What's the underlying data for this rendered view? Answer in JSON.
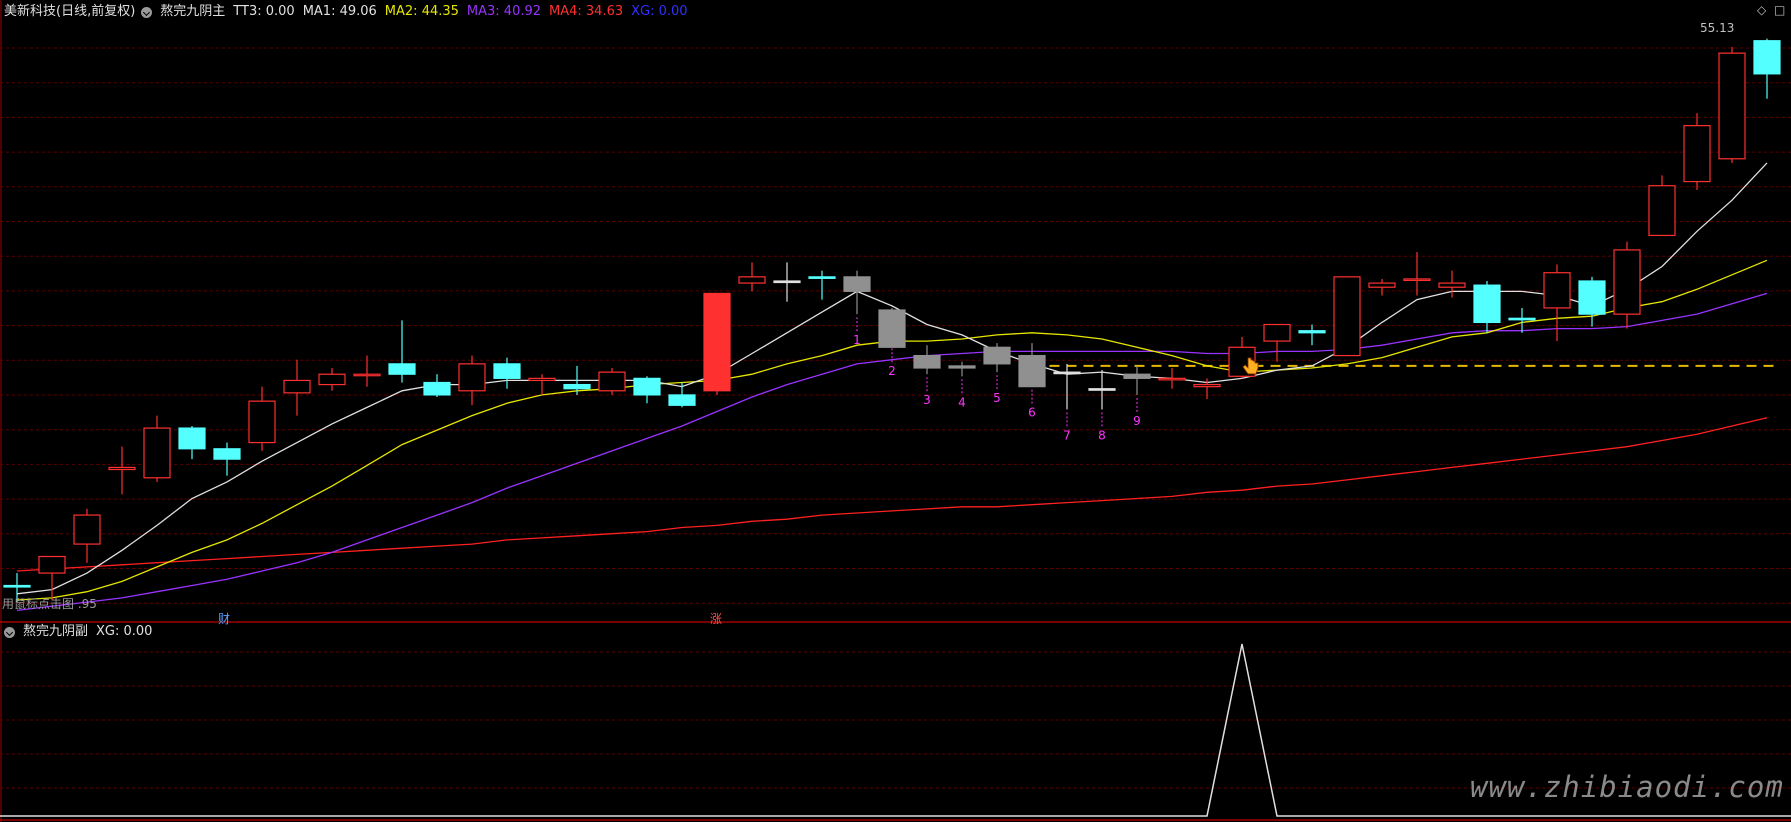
{
  "main_header": {
    "symbol": "美新科技(日线,前复权)",
    "indicator_name": "熬完九阴主",
    "items": [
      {
        "label": "TT3: 0.00",
        "color": "#e0e0e0"
      },
      {
        "label": "MA1: 49.06",
        "color": "#e0e0e0"
      },
      {
        "label": "MA2: 44.35",
        "color": "#e6e600"
      },
      {
        "label": "MA3: 40.92",
        "color": "#9933ff"
      },
      {
        "label": "MA4: 34.63",
        "color": "#ff3030"
      },
      {
        "label": "XG: 0.00",
        "color": "#3030ff"
      }
    ]
  },
  "sub_header": {
    "indicator_name": "熬完九阴副",
    "items": [
      {
        "label": "XG: 0.00",
        "color": "#e0e0e0"
      }
    ]
  },
  "labels": {
    "price_max": "55.13",
    "price_min_text": "用鼠标点击图 .95",
    "marker_cai": "财",
    "marker_zhang": "涨",
    "watermark": "www.zhibiaodi.com",
    "corner_diamond": "◇",
    "corner_box": "□"
  },
  "colors": {
    "up": "#ff3030",
    "down": "#54ffff",
    "neutral": "#909090",
    "grid": "#5a0000",
    "ma1": "#e0e0e0",
    "ma2": "#e6e600",
    "ma3": "#9933ff",
    "ma4": "#ff2020",
    "count": "#ff33ff",
    "support": "#e6b800"
  },
  "chart_data": [
    {
      "type": "candlestick",
      "yscale": [
        28,
        56
      ],
      "support_level": 39.3,
      "candles": [
        {
          "o": 28.7,
          "h": 29.3,
          "l": 27.9,
          "c": 28.7,
          "k": "d"
        },
        {
          "o": 29.3,
          "h": 29.9,
          "l": 28.0,
          "c": 30.1,
          "k": "u"
        },
        {
          "o": 30.7,
          "h": 32.4,
          "l": 29.8,
          "c": 32.1,
          "k": "u"
        },
        {
          "o": 34.3,
          "h": 35.4,
          "l": 33.1,
          "c": 34.4,
          "k": "u"
        },
        {
          "o": 33.9,
          "h": 36.9,
          "l": 33.7,
          "c": 36.3,
          "k": "u"
        },
        {
          "o": 36.3,
          "h": 36.4,
          "l": 34.8,
          "c": 35.3,
          "k": "d"
        },
        {
          "o": 35.3,
          "h": 35.6,
          "l": 34.0,
          "c": 34.8,
          "k": "d"
        },
        {
          "o": 35.6,
          "h": 38.3,
          "l": 35.2,
          "c": 37.6,
          "k": "u"
        },
        {
          "o": 38.0,
          "h": 39.6,
          "l": 36.9,
          "c": 38.6,
          "k": "u"
        },
        {
          "o": 38.4,
          "h": 39.2,
          "l": 38.1,
          "c": 38.9,
          "k": "u"
        },
        {
          "o": 38.9,
          "h": 39.8,
          "l": 38.3,
          "c": 38.9,
          "k": "u"
        },
        {
          "o": 39.4,
          "h": 41.5,
          "l": 38.5,
          "c": 38.9,
          "k": "d"
        },
        {
          "o": 38.5,
          "h": 38.9,
          "l": 37.8,
          "c": 37.9,
          "k": "d"
        },
        {
          "o": 38.1,
          "h": 39.8,
          "l": 37.4,
          "c": 39.4,
          "k": "u"
        },
        {
          "o": 39.4,
          "h": 39.7,
          "l": 38.2,
          "c": 38.7,
          "k": "d"
        },
        {
          "o": 38.7,
          "h": 38.9,
          "l": 37.9,
          "c": 38.6,
          "k": "u"
        },
        {
          "o": 38.4,
          "h": 39.3,
          "l": 37.9,
          "c": 38.2,
          "k": "d"
        },
        {
          "o": 38.1,
          "h": 39.2,
          "l": 37.9,
          "c": 39.0,
          "k": "u"
        },
        {
          "o": 38.7,
          "h": 38.8,
          "l": 37.5,
          "c": 37.9,
          "k": "d"
        },
        {
          "o": 37.9,
          "h": 38.5,
          "l": 37.3,
          "c": 37.4,
          "k": "d"
        },
        {
          "o": 38.1,
          "h": 42.8,
          "l": 37.9,
          "c": 42.8,
          "k": "u",
          "fill": true
        },
        {
          "o": 43.3,
          "h": 44.3,
          "l": 42.9,
          "c": 43.6,
          "k": "u"
        },
        {
          "o": 43.4,
          "h": 44.3,
          "l": 42.4,
          "c": 43.4,
          "k": "n"
        },
        {
          "o": 43.6,
          "h": 43.9,
          "l": 42.5,
          "c": 43.6,
          "k": "d"
        },
        {
          "o": 43.6,
          "h": 43.9,
          "l": 41.8,
          "c": 42.9,
          "k": "g"
        },
        {
          "o": 42.0,
          "h": 42.1,
          "l": 40.3,
          "c": 40.2,
          "k": "g"
        },
        {
          "o": 39.8,
          "h": 40.3,
          "l": 38.9,
          "c": 39.2,
          "k": "g"
        },
        {
          "o": 39.3,
          "h": 39.5,
          "l": 38.8,
          "c": 39.2,
          "k": "g"
        },
        {
          "o": 40.2,
          "h": 40.4,
          "l": 39.0,
          "c": 39.4,
          "k": "g"
        },
        {
          "o": 39.8,
          "h": 40.4,
          "l": 38.3,
          "c": 38.3,
          "k": "g"
        },
        {
          "o": 39.0,
          "h": 39.4,
          "l": 37.2,
          "c": 39.0,
          "k": "n"
        },
        {
          "o": 38.2,
          "h": 39.1,
          "l": 37.2,
          "c": 38.2,
          "k": "n"
        },
        {
          "o": 38.9,
          "h": 39.3,
          "l": 37.9,
          "c": 38.7,
          "k": "g"
        },
        {
          "o": 38.7,
          "h": 39.2,
          "l": 38.2,
          "c": 38.7,
          "k": "u"
        },
        {
          "o": 38.4,
          "h": 38.7,
          "l": 37.7,
          "c": 38.3,
          "k": "u"
        },
        {
          "o": 38.8,
          "h": 40.7,
          "l": 38.7,
          "c": 40.2,
          "k": "u"
        },
        {
          "o": 40.5,
          "h": 41.3,
          "l": 39.5,
          "c": 41.3,
          "k": "u"
        },
        {
          "o": 41.0,
          "h": 41.3,
          "l": 40.3,
          "c": 40.9,
          "k": "d"
        },
        {
          "o": 39.8,
          "h": 43.6,
          "l": 39.8,
          "c": 43.6,
          "k": "u"
        },
        {
          "o": 43.3,
          "h": 43.5,
          "l": 42.7,
          "c": 43.1,
          "k": "u"
        },
        {
          "o": 43.5,
          "h": 44.8,
          "l": 42.7,
          "c": 43.5,
          "k": "u"
        },
        {
          "o": 43.3,
          "h": 43.9,
          "l": 42.6,
          "c": 43.1,
          "k": "u"
        },
        {
          "o": 43.2,
          "h": 43.4,
          "l": 40.9,
          "c": 41.4,
          "k": "d"
        },
        {
          "o": 41.6,
          "h": 42.1,
          "l": 40.9,
          "c": 41.6,
          "k": "d"
        },
        {
          "o": 42.1,
          "h": 44.2,
          "l": 40.5,
          "c": 43.8,
          "k": "u"
        },
        {
          "o": 43.4,
          "h": 43.6,
          "l": 41.2,
          "c": 41.8,
          "k": "d"
        },
        {
          "o": 41.8,
          "h": 45.3,
          "l": 41.1,
          "c": 44.9,
          "k": "u"
        },
        {
          "o": 45.6,
          "h": 48.5,
          "l": 45.6,
          "c": 48.0,
          "k": "u"
        },
        {
          "o": 48.2,
          "h": 51.5,
          "l": 47.8,
          "c": 50.9,
          "k": "u"
        },
        {
          "o": 49.3,
          "h": 54.7,
          "l": 49.1,
          "c": 54.4,
          "k": "u"
        },
        {
          "o": 55.0,
          "h": 55.1,
          "l": 52.2,
          "c": 53.4,
          "k": "d"
        }
      ],
      "ma1": [
        28.3,
        28.5,
        29.3,
        30.4,
        31.6,
        32.9,
        33.7,
        34.7,
        35.6,
        36.5,
        37.3,
        38.1,
        38.4,
        38.4,
        38.6,
        38.6,
        38.6,
        38.6,
        38.6,
        38.3,
        38.9,
        39.9,
        40.9,
        41.9,
        42.9,
        42.2,
        41.3,
        40.8,
        40.0,
        39.4,
        38.9,
        39.0,
        38.8,
        38.7,
        38.5,
        38.7,
        39.1,
        39.3,
        40.2,
        41.4,
        42.5,
        42.9,
        42.9,
        42.9,
        42.7,
        42.2,
        43.0,
        44.1,
        45.8,
        47.3,
        49.1
      ],
      "ma2": [
        28.0,
        28.1,
        28.4,
        28.9,
        29.6,
        30.3,
        30.9,
        31.7,
        32.6,
        33.5,
        34.5,
        35.5,
        36.2,
        36.9,
        37.5,
        37.9,
        38.1,
        38.2,
        38.4,
        38.5,
        38.6,
        38.9,
        39.4,
        39.8,
        40.3,
        40.5,
        40.5,
        40.6,
        40.8,
        40.9,
        40.8,
        40.6,
        40.2,
        39.8,
        39.3,
        39.0,
        39.1,
        39.2,
        39.4,
        39.7,
        40.2,
        40.7,
        40.9,
        41.4,
        41.6,
        41.7,
        42.1,
        42.4,
        43.0,
        43.7,
        44.4
      ],
      "ma3": [
        27.5,
        27.7,
        27.9,
        28.1,
        28.4,
        28.7,
        29.0,
        29.4,
        29.8,
        30.3,
        30.9,
        31.5,
        32.1,
        32.7,
        33.4,
        34.0,
        34.6,
        35.2,
        35.8,
        36.4,
        37.1,
        37.8,
        38.4,
        38.9,
        39.4,
        39.6,
        39.8,
        39.9,
        40.0,
        40.0,
        40.0,
        40.0,
        40.0,
        40.0,
        39.9,
        39.9,
        40.0,
        40.0,
        40.1,
        40.3,
        40.6,
        40.9,
        41.0,
        41.0,
        41.1,
        41.1,
        41.2,
        41.5,
        41.8,
        42.3,
        42.8
      ],
      "ma4": [
        29.4,
        29.5,
        29.6,
        29.7,
        29.8,
        29.9,
        30.0,
        30.1,
        30.2,
        30.3,
        30.4,
        30.5,
        30.6,
        30.7,
        30.9,
        31.0,
        31.1,
        31.2,
        31.3,
        31.5,
        31.6,
        31.8,
        31.9,
        32.1,
        32.2,
        32.3,
        32.4,
        32.5,
        32.5,
        32.6,
        32.7,
        32.8,
        32.9,
        33.0,
        33.2,
        33.3,
        33.5,
        33.6,
        33.8,
        34.0,
        34.2,
        34.4,
        34.6,
        34.8,
        35.0,
        35.2,
        35.4,
        35.7,
        36.0,
        36.4,
        36.8
      ],
      "counts": [
        {
          "i": 24,
          "label": "1"
        },
        {
          "i": 25,
          "label": "2"
        },
        {
          "i": 26,
          "label": "3"
        },
        {
          "i": 27,
          "label": "4"
        },
        {
          "i": 28,
          "label": "5"
        },
        {
          "i": 29,
          "label": "6"
        },
        {
          "i": 30,
          "label": "7"
        },
        {
          "i": 31,
          "label": "8"
        },
        {
          "i": 32,
          "label": "9"
        }
      ]
    },
    {
      "type": "line",
      "series": [
        {
          "values": [
            0,
            0,
            0,
            0,
            0,
            0,
            0,
            0,
            0,
            0,
            0,
            0,
            0,
            0,
            0,
            0,
            0,
            0,
            0,
            0,
            0,
            0,
            0,
            0,
            0,
            0,
            0,
            0,
            0,
            0,
            0,
            0,
            0,
            0,
            0,
            1,
            0,
            0,
            0,
            0,
            0,
            0,
            0,
            0,
            0,
            0,
            0,
            0,
            0,
            0,
            0
          ]
        }
      ]
    }
  ]
}
